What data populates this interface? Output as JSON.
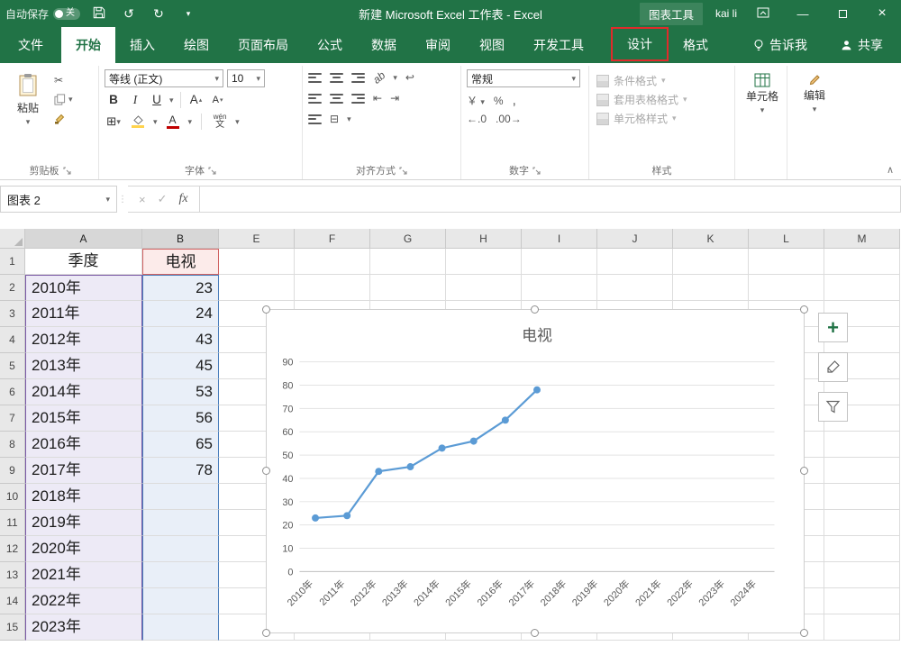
{
  "title_bar": {
    "autosave_label": "自动保存",
    "autosave_state": "关",
    "title": "新建 Microsoft Excel 工作表 - Excel",
    "context_group": "图表工具",
    "user": "kai li"
  },
  "tabs": {
    "file": "文件",
    "main": [
      "开始",
      "插入",
      "绘图",
      "页面布局",
      "公式",
      "数据",
      "审阅",
      "视图",
      "开发工具"
    ],
    "active": "开始",
    "contextual": [
      "设计",
      "格式"
    ],
    "highlighted": "设计",
    "tell_me": "告诉我",
    "share": "共享"
  },
  "ribbon": {
    "clipboard": {
      "paste": "粘贴",
      "label": "剪贴板"
    },
    "font": {
      "family": "等线 (正文)",
      "size": "10",
      "label": "字体",
      "phonetic_top": "wén",
      "phonetic_bottom": "文"
    },
    "alignment": {
      "label": "对齐方式"
    },
    "number": {
      "format": "常规",
      "label": "数字"
    },
    "styles": {
      "items": [
        "条件格式",
        "套用表格格式",
        "单元格样式"
      ],
      "label": "样式"
    },
    "cells_label": "单元格",
    "editing_label": "编辑"
  },
  "formula_bar": {
    "name_box": "图表 2",
    "fx": "fx",
    "value": ""
  },
  "grid": {
    "columns": [
      "A",
      "B",
      "E",
      "F",
      "G",
      "H",
      "I",
      "J",
      "K",
      "L",
      "M"
    ],
    "rows": [
      "1",
      "2",
      "3",
      "4",
      "5",
      "6",
      "7",
      "8",
      "9",
      "10",
      "11",
      "12",
      "13",
      "14",
      "15"
    ],
    "cells": {
      "A": [
        "季度",
        "2010年",
        "2011年",
        "2012年",
        "2013年",
        "2014年",
        "2015年",
        "2016年",
        "2017年",
        "2018年",
        "2019年",
        "2020年",
        "2021年",
        "2022年",
        "2023年"
      ],
      "B": [
        "电视",
        "23",
        "24",
        "43",
        "45",
        "53",
        "56",
        "65",
        "78",
        "",
        "",
        "",
        "",
        "",
        ""
      ]
    }
  },
  "chart_data": {
    "type": "line",
    "title": "电视",
    "categories": [
      "2010年",
      "2011年",
      "2012年",
      "2013年",
      "2014年",
      "2015年",
      "2016年",
      "2017年",
      "2018年",
      "2019年",
      "2020年",
      "2021年",
      "2022年",
      "2023年",
      "2024年"
    ],
    "values": [
      23,
      24,
      43,
      45,
      53,
      56,
      65,
      78,
      null,
      null,
      null,
      null,
      null,
      null,
      null
    ],
    "ylim": [
      0,
      90
    ],
    "ytick_step": 10,
    "grid": true,
    "legend": false,
    "line_color": "#5b9bd5",
    "xlabel": "",
    "ylabel": ""
  },
  "icons": {
    "dropdown": "▾",
    "up": "▴",
    "cut": "✂",
    "undo": "↺",
    "redo": "↻",
    "cancel": "×",
    "enter": "✓",
    "bold": "B",
    "italic": "I",
    "underline": "U",
    "grow_font": "A",
    "shrink_font": "A",
    "borders": "⊞",
    "merge": "⊟",
    "wrap": "↩",
    "indent_left": "⇤",
    "indent_right": "⇥",
    "orientation": "ab",
    "font_color": "A",
    "currency": "￥",
    "percent": "%",
    "comma": ",",
    "inc_decimal": "←.0",
    "dec_decimal": ".00→",
    "collapse_ribbon": "∧",
    "minimize": "—",
    "close": "×",
    "plus": "+"
  }
}
